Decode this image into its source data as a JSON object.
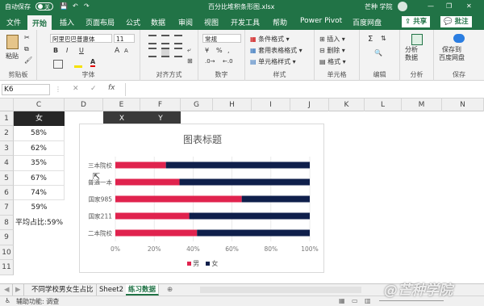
{
  "titlebar": {
    "autosave": "自动保存",
    "autosave_state": "关",
    "filename": "百分比堆积条形图.xlsx",
    "user": "芒种 学院"
  },
  "tabs": [
    "文件",
    "开始",
    "插入",
    "页面布局",
    "公式",
    "数据",
    "审阅",
    "视图",
    "开发工具",
    "帮助",
    "Power Pivot",
    "百度网盘"
  ],
  "tab_right": {
    "share": "共享",
    "comment": "批注"
  },
  "ribbon": {
    "clipboard": {
      "paste": "粘贴",
      "label": "剪贴板"
    },
    "font": {
      "name": "阿里巴巴普惠体",
      "size": "11",
      "label": "字体",
      "bold": "B",
      "italic": "I",
      "underline": "U",
      "grow": "A",
      "shrink": "A"
    },
    "align": {
      "label": "对齐方式"
    },
    "number": {
      "format": "常规",
      "percent": "%",
      "comma": ",",
      "label": "数字"
    },
    "styles": {
      "cond": "条件格式",
      "table": "套用表格格式",
      "cell": "单元格样式",
      "label": "样式"
    },
    "cells": {
      "insert": "插入",
      "delete": "删除",
      "format": "格式",
      "label": "单元格"
    },
    "edit": {
      "label": "编辑"
    },
    "analysis": {
      "btn": "分析\n数据",
      "label": "分析"
    },
    "save": {
      "btn": "保存到\n百度网盘",
      "label": "保存"
    }
  },
  "formula_bar": {
    "namebox": "K6",
    "fx": "fx",
    "cancel": "✕",
    "enter": "✓",
    "value": ""
  },
  "columns": [
    "C",
    "D",
    "E",
    "F",
    "G",
    "H",
    "I",
    "J",
    "K",
    "L",
    "M",
    "N"
  ],
  "rows": [
    "1",
    "2",
    "3",
    "4",
    "5",
    "6",
    "7",
    "8",
    "9",
    "10",
    "11"
  ],
  "cells": {
    "c1": "女",
    "c_values": [
      "58%",
      "62%",
      "35%",
      "67%",
      "74%",
      "59%"
    ],
    "avg_label": "平均占比:59%",
    "e1": "X",
    "f1": "Y"
  },
  "chart_data": {
    "type": "bar",
    "stacked": "percent",
    "title": "图表标题",
    "categories": [
      "三本院校",
      "普通一本",
      "国家985",
      "国家211",
      "二本院校"
    ],
    "series": [
      {
        "name": "男",
        "color": "#e0234e",
        "values": [
          26,
          33,
          65,
          38,
          42
        ]
      },
      {
        "name": "女",
        "color": "#0f1f4b",
        "values": [
          74,
          67,
          35,
          62,
          58
        ]
      }
    ],
    "xticks": [
      "0%",
      "20%",
      "40%",
      "60%",
      "80%",
      "100%"
    ],
    "xlim": [
      0,
      100
    ],
    "legend": "bottom"
  },
  "sheet_tabs": [
    "不同学校男女生占比",
    "Sheet2",
    "练习数据"
  ],
  "active_sheet": "练习数据",
  "status": {
    "text": "辅助功能: 调查"
  },
  "watermark": "@芒种学院"
}
